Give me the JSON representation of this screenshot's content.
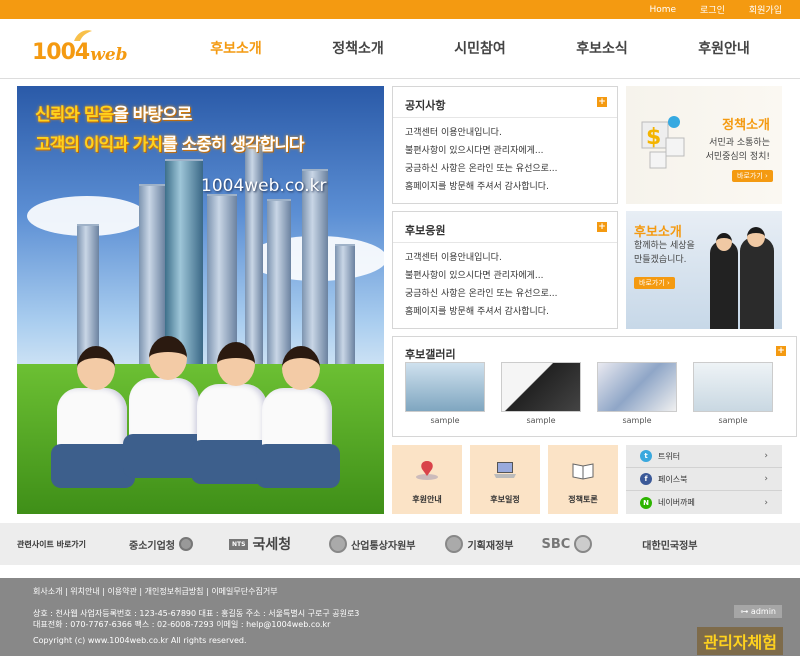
{
  "top_links": [
    "Home",
    "로그인",
    "회원가입"
  ],
  "logo": {
    "num": "1004",
    "web": "web"
  },
  "gnb": [
    "후보소개",
    "정책소개",
    "시민참여",
    "후보소식",
    "후원안내"
  ],
  "visual": {
    "line1a": "신뢰와 믿음",
    "line1b": "을 바탕으로",
    "line2a": "고객의 이익과 가치",
    "line2b": "를 소중히 생각합니다",
    "url": "1004web.co.kr"
  },
  "notice": {
    "title": "공지사항",
    "items": [
      "고객센터 이용안내입니다.",
      "불편사항이 있으시다면 관리자에게...",
      "궁금하신 사항은 온라인 또는 유선으로...",
      "홈페이지를 방문해 주셔서 감사합니다."
    ]
  },
  "support": {
    "title": "후보응원",
    "items": [
      "고객센터 이용안내입니다.",
      "불편사항이 있으시다면 관리자에게...",
      "궁금하신 사항은 온라인 또는 유선으로...",
      "홈페이지를 방문해 주셔서 감사합니다."
    ]
  },
  "banner_policy": {
    "title": "정책소개",
    "desc1": "서민과 소통하는",
    "desc2": "서민중심의 정치!",
    "btn": "바로가기 ›"
  },
  "banner_cand": {
    "title": "후보소개",
    "desc1": "함께하는 세상을",
    "desc2": "만들겠습니다.",
    "btn": "바로가기 ›"
  },
  "gallery": {
    "title": "후보갤러리",
    "caps": [
      "sample",
      "sample",
      "sample",
      "sample"
    ]
  },
  "quick": [
    "후원안내",
    "후보일정",
    "정책토론"
  ],
  "sns": [
    {
      "icon": "t",
      "label": "트위터",
      "color": "#3aa8de"
    },
    {
      "icon": "f",
      "label": "페이스북",
      "color": "#3b5998"
    },
    {
      "icon": "N",
      "label": "네이버까페",
      "color": "#2db400"
    }
  ],
  "related": {
    "label": "관련사이트 바로가기",
    "orgs": [
      "중소기업청",
      "국세청",
      "산업통상자원부",
      "기획재정부",
      "SBC",
      "대한민국정부"
    ]
  },
  "footer": {
    "links": "회사소개 | 위치안내 | 이용약관 | 개인정보취급방침 | 이메일무단수집거부",
    "addr1": "상호 : 천사웹   사업자등록번호 : 123-45-67890  대표 : 홍길동  주소 : 서울특별시 구로구 공원로3",
    "addr2": "대표전화 : 070-7767-6366  팩스 : 02-6008-7293  이메일 : help@1004web.co.kr",
    "copy": "Copyright (c) www.1004web.co.kr All rights reserved.",
    "admin": "⊶ admin",
    "exp": "관리자체험"
  }
}
